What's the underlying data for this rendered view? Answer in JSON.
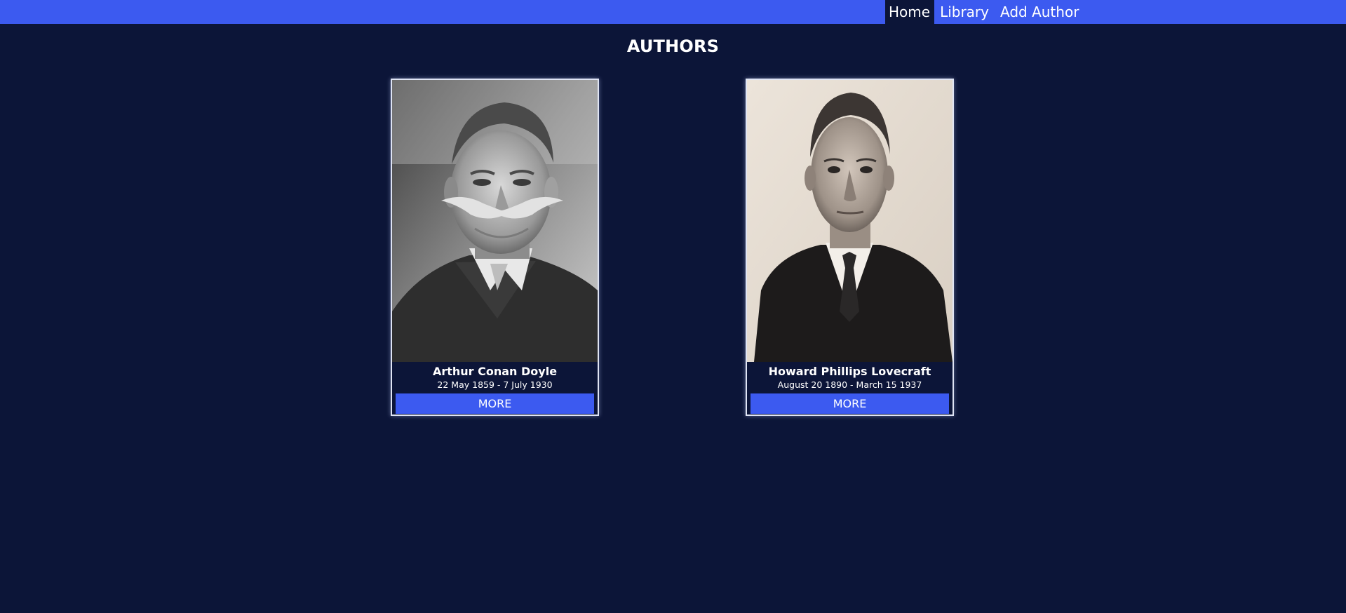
{
  "nav": {
    "items": [
      {
        "label": "Home",
        "active": true
      },
      {
        "label": "Library",
        "active": false
      },
      {
        "label": "Add Author",
        "active": false
      }
    ]
  },
  "page": {
    "title": "AUTHORS"
  },
  "authors": [
    {
      "name": "Arthur Conan Doyle",
      "dates": "22 May 1859 - 7 July 1930",
      "button_label": "MORE"
    },
    {
      "name": "Howard Phillips Lovecraft",
      "dates": "August 20 1890 - March 15 1937",
      "button_label": "MORE"
    }
  ],
  "colors": {
    "background": "#0c1538",
    "accent": "#3c5af0",
    "text": "#ffffff"
  }
}
